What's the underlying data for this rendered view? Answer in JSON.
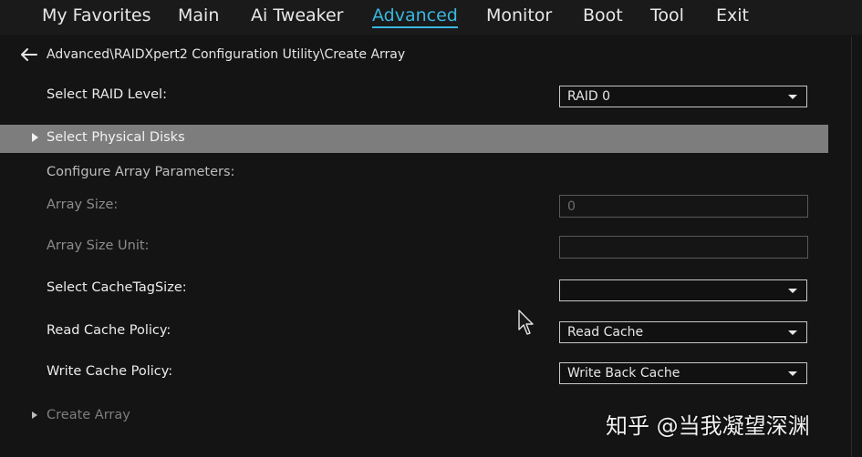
{
  "nav": {
    "items": [
      {
        "label": "My Favorites"
      },
      {
        "label": "Main"
      },
      {
        "label": "Ai Tweaker"
      },
      {
        "label": "Advanced",
        "active": true
      },
      {
        "label": "Monitor"
      },
      {
        "label": "Boot"
      },
      {
        "label": "Tool"
      },
      {
        "label": "Exit"
      }
    ]
  },
  "breadcrumb": {
    "icon": "back-arrow-icon",
    "path": "Advanced\\RAIDXpert2 Configuration Utility\\Create Array"
  },
  "form": {
    "raid_level": {
      "label": "Select RAID Level:",
      "value": "RAID 0"
    },
    "physical_disks": {
      "label": "Select Physical Disks"
    },
    "configure_header": {
      "label": "Configure Array Parameters:"
    },
    "array_size": {
      "label": "Array Size:",
      "value": "0"
    },
    "array_size_unit": {
      "label": "Array Size Unit:",
      "value": ""
    },
    "cache_tag_size": {
      "label": "Select CacheTagSize:",
      "value": ""
    },
    "read_cache_policy": {
      "label": "Read Cache Policy:",
      "value": "Read Cache"
    },
    "write_cache_policy": {
      "label": "Write Cache Policy:",
      "value": "Write Back Cache"
    },
    "create_array": {
      "label": "Create Array"
    }
  },
  "watermark": "知乎 @当我凝望深渊",
  "colors": {
    "accent": "#39b7e0",
    "background": "#141414",
    "highlight": "#7d7d7d"
  }
}
